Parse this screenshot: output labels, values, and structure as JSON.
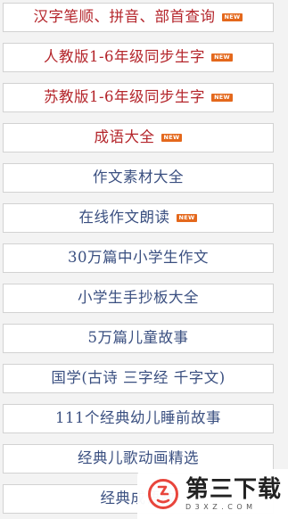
{
  "nav": {
    "badge_label": "NEW",
    "items": [
      {
        "label": "汉字笔顺、拼音、部首查询",
        "style": "red",
        "badge": true
      },
      {
        "label": "人教版1-6年级同步生字",
        "style": "red",
        "badge": true
      },
      {
        "label": "苏教版1-6年级同步生字",
        "style": "red",
        "badge": true
      },
      {
        "label": "成语大全",
        "style": "red",
        "badge": true
      },
      {
        "label": "作文素材大全",
        "style": "blue",
        "badge": false
      },
      {
        "label": "在线作文朗读",
        "style": "blue",
        "badge": true
      },
      {
        "label": "30万篇中小学生作文",
        "style": "blue",
        "badge": false
      },
      {
        "label": "小学生手抄板大全",
        "style": "blue",
        "badge": false
      },
      {
        "label": "5万篇儿童故事",
        "style": "blue",
        "badge": false
      },
      {
        "label": "国学(古诗  三字经  千字文)",
        "style": "blue",
        "badge": false
      },
      {
        "label": "111个经典幼儿睡前故事",
        "style": "blue",
        "badge": false
      },
      {
        "label": "经典儿歌动画精选",
        "style": "blue",
        "badge": false
      },
      {
        "label": "经典成语故",
        "style": "blue",
        "badge": false
      }
    ]
  },
  "watermark": {
    "title": "第三下载",
    "domain": "D3XZ.COM",
    "logo_icon": "download-logo-icon"
  },
  "colors": {
    "red_text": "#b4252b",
    "blue_text": "#3a4f80",
    "badge_bg": "#e4681c",
    "logo_red": "#e8453c"
  }
}
